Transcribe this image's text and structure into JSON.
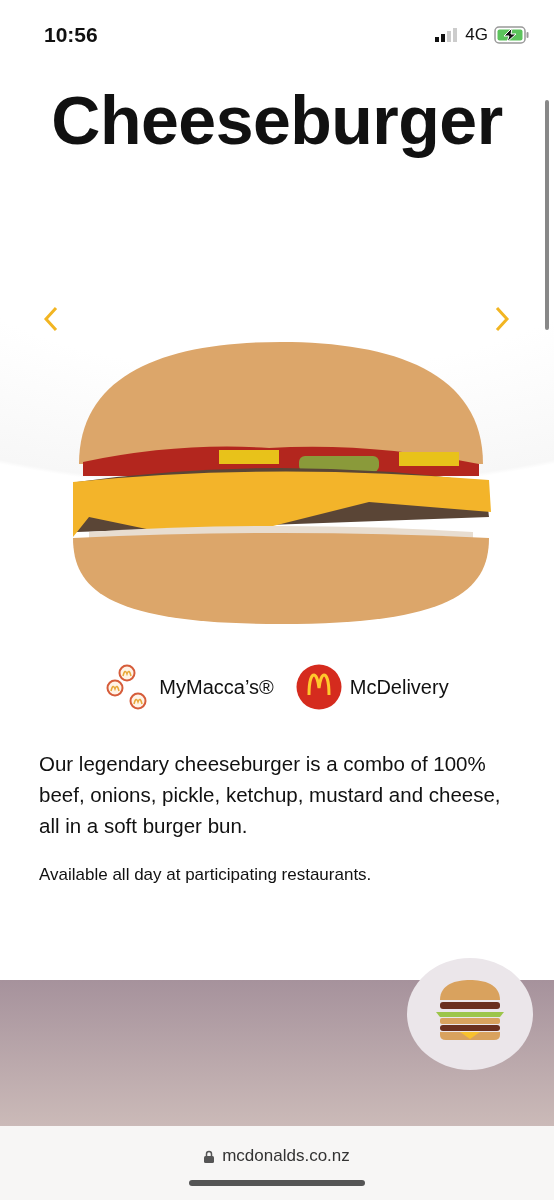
{
  "status_bar": {
    "time": "10:56",
    "network": "4G"
  },
  "title": "Cheeseburger",
  "links": [
    {
      "label": "MyMacca’s®",
      "kind": "coins"
    },
    {
      "label": "McDelivery",
      "kind": "logo"
    }
  ],
  "description": "Our legendary cheeseburger is a combo of 100% beef, onions, pickle, ketchup, mustard and cheese, all in a soft burger bun.",
  "note": "Available all day at participating restaurants.",
  "browser": {
    "url": "mcdonalds.co.nz"
  }
}
